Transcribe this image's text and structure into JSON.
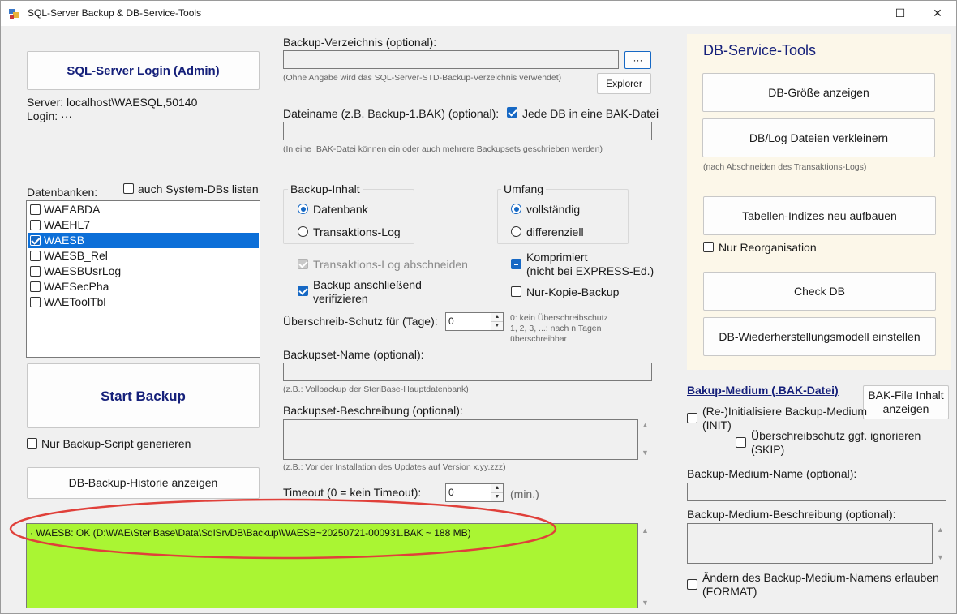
{
  "window": {
    "title": "SQL-Server Backup & DB-Service-Tools",
    "min_glyph": "—",
    "max_glyph": "☐",
    "close_glyph": "✕"
  },
  "left": {
    "login_button": "SQL-Server Login (Admin)",
    "server_line": "Server: localhost\\WAESQL,50140",
    "login_line": "Login: ···",
    "databases_label": "Datenbanken:",
    "system_dbs_label": "auch System-DBs listen",
    "databases": [
      {
        "name": "WAEABDA",
        "checked": false,
        "selected": false
      },
      {
        "name": "WAEHL7",
        "checked": false,
        "selected": false
      },
      {
        "name": "WAESB",
        "checked": true,
        "selected": true
      },
      {
        "name": "WAESB_Rel",
        "checked": false,
        "selected": false
      },
      {
        "name": "WAESBUsrLog",
        "checked": false,
        "selected": false
      },
      {
        "name": "WAESecPha",
        "checked": false,
        "selected": false
      },
      {
        "name": "WAEToolTbl",
        "checked": false,
        "selected": false
      }
    ],
    "start_backup": "Start Backup",
    "script_only_label": "Nur Backup-Script generieren",
    "history_button": "DB-Backup-Historie anzeigen"
  },
  "middle": {
    "backup_dir_label": "Backup-Verzeichnis (optional):",
    "backup_dir_value": "",
    "browse_button": "···",
    "backup_dir_hint": "(Ohne Angabe wird das SQL-Server-STD-Backup-Verzeichnis verwendet)",
    "explorer_button": "Explorer",
    "filename_label": "Dateiname (z.B. Backup-1.BAK) (optional):",
    "each_db_label": "Jede DB in eine BAK-Datei",
    "filename_value": "",
    "filename_hint": "(In eine .BAK-Datei können ein oder auch mehrere Backupsets geschrieben werden)",
    "content_group": "Backup-Inhalt",
    "content_db": "Datenbank",
    "content_log": "Transaktions-Log",
    "scope_group": "Umfang",
    "scope_full": "vollständig",
    "scope_diff": "differenziell",
    "truncate_log": "Transaktions-Log abschneiden",
    "compressed_line1": "Komprimiert",
    "compressed_line2": "(nicht bei EXPRESS-Ed.)",
    "verify_line1": "Backup anschließend",
    "verify_line2": "verifizieren",
    "copy_only": "Nur-Kopie-Backup",
    "overwrite_label": "Überschreib-Schutz für (Tage):",
    "overwrite_value": "0",
    "overwrite_hint1": "0: kein Überschreibschutz",
    "overwrite_hint2": "1, 2, 3, ...: nach n Tagen",
    "overwrite_hint3": "überschreibbar",
    "set_name_label": "Backupset-Name (optional):",
    "set_name_value": "",
    "set_name_hint": "(z.B.:  Vollbackup der SteriBase-Hauptdatenbank)",
    "set_desc_label": "Backupset-Beschreibung (optional):",
    "set_desc_value": "",
    "set_desc_hint": "(z.B.:  Vor der Installation des Updates auf Version x.yy.zzz)",
    "timeout_label": "Timeout (0 = kein Timeout):",
    "timeout_value": "0",
    "timeout_unit": "(min.)"
  },
  "log": {
    "line": "· WAESB: OK (D:\\WAE\\SteriBase\\Data\\SqlSrvDB\\Backup\\WAESB~20250721-000931.BAK ~ 188 MB)"
  },
  "right": {
    "title": "DB-Service-Tools",
    "db_size_button": "DB-Größe anzeigen",
    "shrink_button": "DB/Log Dateien verkleinern",
    "shrink_hint": "(nach Abschneiden des Transaktions-Logs)",
    "rebuild_button": "Tabellen-Indizes neu aufbauen",
    "reorg_only": "Nur Reorganisation",
    "check_db_button": "Check DB",
    "recovery_button": "DB-Wiederherstellungsmodell einstellen",
    "medium_title": "Bakup-Medium (.BAK-Datei)",
    "bak_info_line1": "BAK-File Inhalt",
    "bak_info_line2": "anzeigen",
    "init_line1": "(Re-)Initialisiere Backup-Medium",
    "init_line2": "(INIT)",
    "skip_line1": "Überschreibschutz ggf. ignorieren",
    "skip_line2": "(SKIP)",
    "medium_name_label": "Backup-Medium-Name (optional):",
    "medium_name_value": "",
    "medium_desc_label": "Backup-Medium-Beschreibung (optional):",
    "medium_desc_value": "",
    "format_line1": "Ändern des Backup-Medium-Namens erlauben",
    "format_line2": "(FORMAT)"
  },
  "colors": {
    "log_background": "#aaf533",
    "selection": "#0c6fd8",
    "service_panel": "#fcf7e9",
    "annotation_ellipse": "#e0403a"
  }
}
